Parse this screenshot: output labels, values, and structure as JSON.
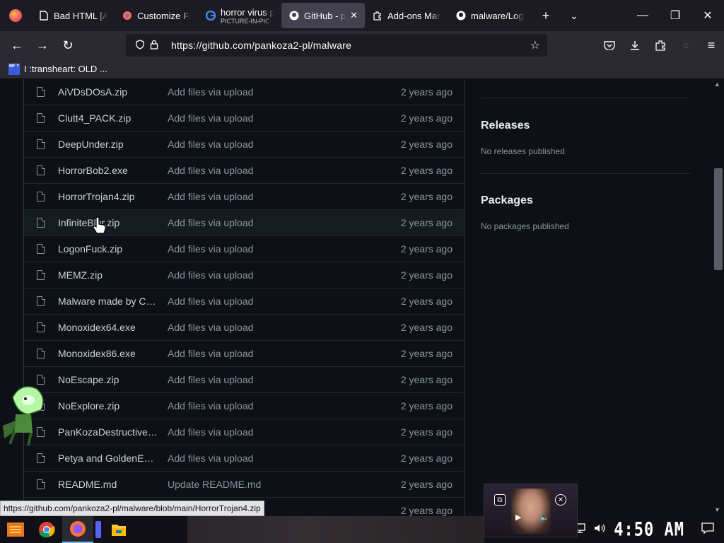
{
  "browser": {
    "tabs": [
      {
        "title": "Bad HTML [ANAL",
        "icon": "document-icon",
        "active": false
      },
      {
        "title": "Customize Fir",
        "icon": "firefox-customize-icon",
        "active": false
      },
      {
        "title": "horror virus p",
        "subtitle": "PICTURE-IN-PIC",
        "icon": "google-icon",
        "active": false
      },
      {
        "title": "GitHub - pa",
        "icon": "github-icon",
        "active": true
      },
      {
        "title": "Add-ons Mana",
        "icon": "puzzle-icon",
        "active": false
      },
      {
        "title": "malware/Logo",
        "icon": "github-icon",
        "active": false
      }
    ],
    "url": "https://github.com/pankoza2-pl/malware",
    "bookmark": {
      "label": "I :transheart: OLD ...",
      "icon_text": "MF T"
    }
  },
  "repo": {
    "files": [
      {
        "name": "AiVDsDOsA.zip",
        "message": "Add files via upload",
        "date": "2 years ago"
      },
      {
        "name": "Clutt4_PACK.zip",
        "message": "Add files via upload",
        "date": "2 years ago"
      },
      {
        "name": "DeepUnder.zip",
        "message": "Add files via upload",
        "date": "2 years ago"
      },
      {
        "name": "HorrorBob2.exe",
        "message": "Add files via upload",
        "date": "2 years ago"
      },
      {
        "name": "HorrorTrojan4.zip",
        "message": "Add files via upload",
        "date": "2 years ago"
      },
      {
        "name": "InfiniteBlur.zip",
        "message": "Add files via upload",
        "date": "2 years ago"
      },
      {
        "name": "LogonFuck.zip",
        "message": "Add files via upload",
        "date": "2 years ago"
      },
      {
        "name": "MEMZ.zip",
        "message": "Add files via upload",
        "date": "2 years ago"
      },
      {
        "name": "Malware made by Co...",
        "message": "Add files via upload",
        "date": "2 years ago"
      },
      {
        "name": "Monoxidex64.exe",
        "message": "Add files via upload",
        "date": "2 years ago"
      },
      {
        "name": "Monoxidex86.exe",
        "message": "Add files via upload",
        "date": "2 years ago"
      },
      {
        "name": "NoEscape.zip",
        "message": "Add files via upload",
        "date": "2 years ago"
      },
      {
        "name": "NoExplore.zip",
        "message": "Add files via upload",
        "date": "2 years ago"
      },
      {
        "name": "PanKozaDestructive.zip",
        "message": "Add files via upload",
        "date": "2 years ago"
      },
      {
        "name": "Petya and GoldenEye...",
        "message": "Add files via upload",
        "date": "2 years ago"
      },
      {
        "name": "README.md",
        "message": "Update README.md",
        "date": "2 years ago"
      },
      {
        "name": "",
        "message": "",
        "date": "2 years ago"
      }
    ],
    "sidebar": {
      "releases_title": "Releases",
      "releases_text": "No releases published",
      "packages_title": "Packages",
      "packages_text": "No packages published"
    }
  },
  "status_url": "https://github.com/pankoza2-pl/malware/blob/main/HorrorTrojan4.zip",
  "taskbar": {
    "clock": "4:50 AM",
    "apps": [
      "start-app-icon",
      "chrome-icon",
      "firefox-icon",
      "discord-icon",
      "file-explorer-icon"
    ]
  },
  "colors": {
    "page_bg": "#0d1117",
    "tab_bar": "#1c1b22",
    "toolbar": "#2b2a33",
    "muted_text": "#8b949e"
  }
}
